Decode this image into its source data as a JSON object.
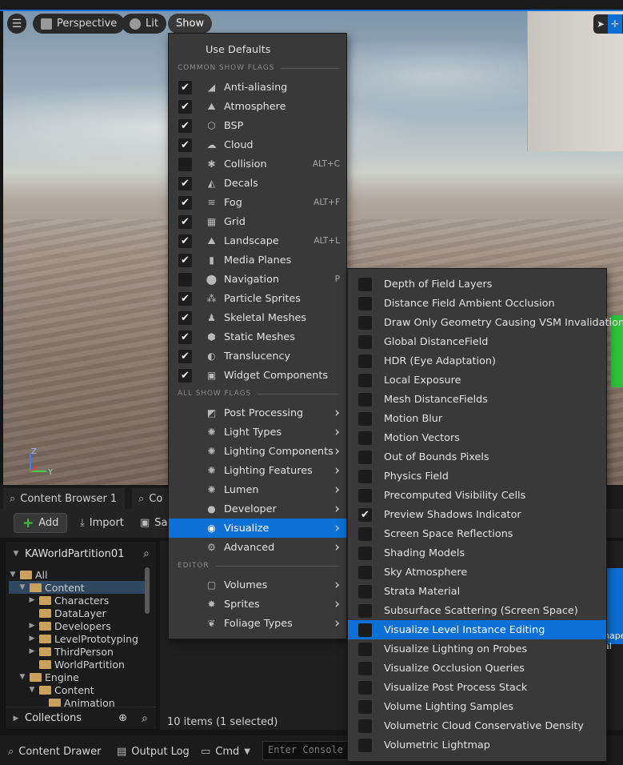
{
  "viewport": {
    "menu_icon": "hamburger-icon",
    "perspective_label": "Perspective",
    "lit_label": "Lit",
    "show_label": "Show",
    "gizmo_z": "Z",
    "gizmo_y": "Y"
  },
  "show_menu": {
    "use_defaults": "Use Defaults",
    "section_common": "COMMON SHOW FLAGS",
    "section_all": "ALL SHOW FLAGS",
    "section_editor": "EDITOR",
    "common_flags": [
      {
        "label": "Anti-aliasing",
        "checked": true,
        "shortcut": "",
        "icon": "antialias-icon"
      },
      {
        "label": "Atmosphere",
        "checked": true,
        "shortcut": "",
        "icon": "atmosphere-icon"
      },
      {
        "label": "BSP",
        "checked": true,
        "shortcut": "",
        "icon": "bsp-icon"
      },
      {
        "label": "Cloud",
        "checked": true,
        "shortcut": "",
        "icon": "cloud-icon"
      },
      {
        "label": "Collision",
        "checked": false,
        "shortcut": "ALT+C",
        "icon": "collision-icon"
      },
      {
        "label": "Decals",
        "checked": true,
        "shortcut": "",
        "icon": "decals-icon"
      },
      {
        "label": "Fog",
        "checked": true,
        "shortcut": "ALT+F",
        "icon": "fog-icon"
      },
      {
        "label": "Grid",
        "checked": true,
        "shortcut": "",
        "icon": "grid-icon"
      },
      {
        "label": "Landscape",
        "checked": true,
        "shortcut": "ALT+L",
        "icon": "landscape-icon"
      },
      {
        "label": "Media Planes",
        "checked": true,
        "shortcut": "",
        "icon": "media-planes-icon"
      },
      {
        "label": "Navigation",
        "checked": false,
        "shortcut": "P",
        "icon": "navigation-icon"
      },
      {
        "label": "Particle Sprites",
        "checked": true,
        "shortcut": "",
        "icon": "particle-icon"
      },
      {
        "label": "Skeletal Meshes",
        "checked": true,
        "shortcut": "",
        "icon": "skeletal-icon"
      },
      {
        "label": "Static Meshes",
        "checked": true,
        "shortcut": "",
        "icon": "static-mesh-icon"
      },
      {
        "label": "Translucency",
        "checked": true,
        "shortcut": "",
        "icon": "translucency-icon"
      },
      {
        "label": "Widget Components",
        "checked": true,
        "shortcut": "",
        "icon": "widget-icon"
      }
    ],
    "all_flags": [
      {
        "label": "Post Processing",
        "icon": "post-processing-icon"
      },
      {
        "label": "Light Types",
        "icon": "light-types-icon"
      },
      {
        "label": "Lighting Components",
        "icon": "lighting-components-icon"
      },
      {
        "label": "Lighting Features",
        "icon": "lighting-features-icon"
      },
      {
        "label": "Lumen",
        "icon": "lumen-icon"
      },
      {
        "label": "Developer",
        "icon": "developer-icon"
      },
      {
        "label": "Visualize",
        "icon": "visualize-icon",
        "highlighted": true
      },
      {
        "label": "Advanced",
        "icon": "advanced-icon"
      }
    ],
    "editor_flags": [
      {
        "label": "Volumes",
        "icon": "volumes-icon"
      },
      {
        "label": "Sprites",
        "icon": "sprites-icon"
      },
      {
        "label": "Foliage Types",
        "icon": "foliage-icon"
      }
    ]
  },
  "visualize_submenu": [
    {
      "label": "Depth of Field Layers",
      "checked": false
    },
    {
      "label": "Distance Field Ambient Occlusion",
      "checked": false
    },
    {
      "label": "Draw Only Geometry Causing VSM Invalidation",
      "checked": false
    },
    {
      "label": "Global DistanceField",
      "checked": false
    },
    {
      "label": "HDR (Eye Adaptation)",
      "checked": false
    },
    {
      "label": "Local Exposure",
      "checked": false
    },
    {
      "label": "Mesh DistanceFields",
      "checked": false
    },
    {
      "label": "Motion Blur",
      "checked": false
    },
    {
      "label": "Motion Vectors",
      "checked": false
    },
    {
      "label": "Out of Bounds Pixels",
      "checked": false
    },
    {
      "label": "Physics Field",
      "checked": false
    },
    {
      "label": "Precomputed Visibility Cells",
      "checked": false
    },
    {
      "label": "Preview Shadows Indicator",
      "checked": true
    },
    {
      "label": "Screen Space Reflections",
      "checked": false
    },
    {
      "label": "Shading Models",
      "checked": false
    },
    {
      "label": "Sky Atmosphere",
      "checked": false
    },
    {
      "label": "Strata Material",
      "checked": false
    },
    {
      "label": "Subsurface Scattering (Screen Space)",
      "checked": false
    },
    {
      "label": "Visualize Level Instance Editing",
      "checked": false,
      "highlighted": true
    },
    {
      "label": "Visualize Lighting on Probes",
      "checked": false
    },
    {
      "label": "Visualize Occlusion Queries",
      "checked": false
    },
    {
      "label": "Visualize Post Process Stack",
      "checked": false
    },
    {
      "label": "Volume Lighting Samples",
      "checked": false
    },
    {
      "label": "Volumetric Cloud Conservative Density",
      "checked": false
    },
    {
      "label": "Volumetric Lightmap",
      "checked": false
    }
  ],
  "content_browser": {
    "tab1": "Content Browser 1",
    "tab2": "Co",
    "add_label": "Add",
    "import_label": "Import",
    "save_label": "Sav",
    "project_name": "KAWorldPartition01",
    "collections_label": "Collections",
    "items_status": "10 items (1 selected)",
    "tile_text": "hape\nal",
    "tree": [
      {
        "label": "All",
        "depth": 0,
        "expanded": true,
        "selected": false
      },
      {
        "label": "Content",
        "depth": 1,
        "expanded": true,
        "selected": true
      },
      {
        "label": "Characters",
        "depth": 2,
        "expanded": false,
        "selected": false
      },
      {
        "label": "DataLayer",
        "depth": 2,
        "expanded": null,
        "selected": false
      },
      {
        "label": "Developers",
        "depth": 2,
        "expanded": false,
        "selected": false
      },
      {
        "label": "LevelPrototyping",
        "depth": 2,
        "expanded": false,
        "selected": false
      },
      {
        "label": "ThirdPerson",
        "depth": 2,
        "expanded": false,
        "selected": false
      },
      {
        "label": "WorldPartition",
        "depth": 2,
        "expanded": null,
        "selected": false
      },
      {
        "label": "Engine",
        "depth": 1,
        "expanded": true,
        "selected": false
      },
      {
        "label": "Content",
        "depth": 2,
        "expanded": true,
        "selected": false
      },
      {
        "label": "Animation",
        "depth": 3,
        "expanded": null,
        "selected": false
      }
    ]
  },
  "status_bar": {
    "content_drawer": "Content Drawer",
    "output_log": "Output Log",
    "cmd": "Cmd",
    "console_placeholder": "Enter Console"
  }
}
